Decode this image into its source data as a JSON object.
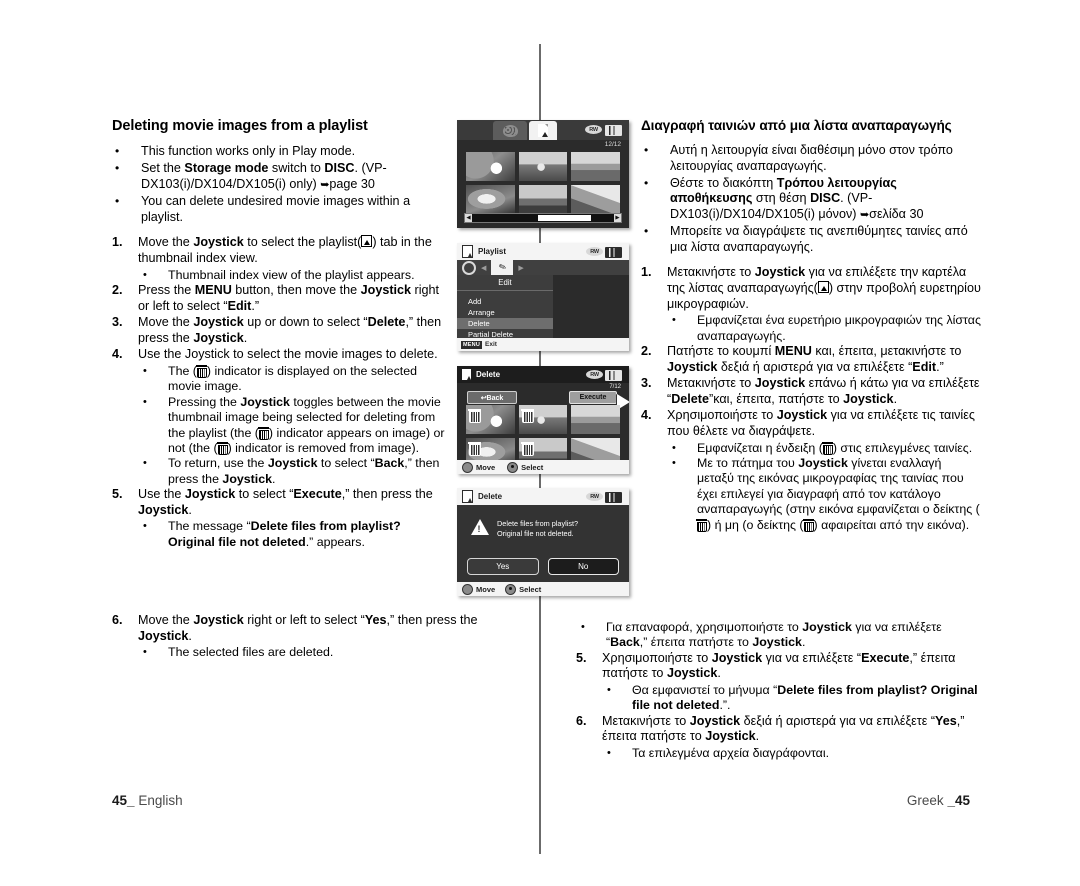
{
  "footer": {
    "left_page": "45",
    "left_sep": "_",
    "left_lang": "English",
    "right_lang": "Greek",
    "right_sep": "_",
    "right_page": "45"
  },
  "english": {
    "heading": "Deleting movie images from a playlist",
    "intro": [
      "This function works only in Play mode.",
      "Set the Storage mode switch to DISC. (VP-DX103(i)/DX104/DX105(i) only) ➜page 30",
      "You can delete undesired movie images within a playlist."
    ],
    "steps": [
      {
        "num": "1.",
        "text": "Move the Joystick to select the playlist(▣) tab in the thumbnail index view.",
        "subs": [
          "Thumbnail index view of the playlist appears."
        ]
      },
      {
        "num": "2.",
        "text": "Press the MENU button, then move the Joystick right or left to select “Edit.”",
        "subs": []
      },
      {
        "num": "3.",
        "text": "Move the Joystick up or down to select “Delete,” then press the Joystick.",
        "subs": []
      },
      {
        "num": "4.",
        "text": "Use the Joystick to select the movie images to delete.",
        "subs": [
          "The (☒) indicator is displayed on the selected movie image.",
          "Pressing the Joystick toggles between the movie thumbnail image being selected for deleting from the playlist (the (☒) indicator appears on image) or not (the (☒) indicator is removed from image).",
          "To return, use the Joystick to select “Back,” then press the Joystick."
        ]
      },
      {
        "num": "5.",
        "text": "Use the Joystick to select “Execute,” then press the Joystick.",
        "subs": [
          "The message “Delete files from playlist? Original file not deleted.” appears."
        ]
      },
      {
        "num": "6.",
        "text": "Move the Joystick right or left to select “Yes,” then press the Joystick.",
        "subs": [
          "The selected files are deleted."
        ]
      }
    ]
  },
  "greek": {
    "heading": "Διαγραφή ταινιών από μια λίστα αναπαραγωγής",
    "intro": [
      "Αυτή η λειτουργία είναι διαθέσιμη μόνο στον τρόπο λειτουργίας αναπαραγωγής.",
      "Θέστε το διακόπτη Τρόπου λειτουργίας αποθήκευσης στη θέση DISC. (VP-DX103(i)/DX104/DX105(i) μόνον) ➜σελίδα 30",
      "Μπορείτε να διαγράψετε τις ανεπιθύμητες ταινίες από μια λίστα αναπαραγωγής."
    ],
    "steps": [
      {
        "num": "1.",
        "text": "Μετακινήστε το Joystick για να επιλέξετε την καρτέλα της λίστας αναπαραγωγής(▣) στην προβολή ευρετηρίου μικρογραφιών.",
        "subs": [
          "Εμφανίζεται ένα ευρετήριο μικρογραφιών της λίστας αναπαραγωγής."
        ]
      },
      {
        "num": "2.",
        "text": "Πατήστε το κουμπί MENU και, έπειτα, μετακινήστε το Joystick δεξιά ή αριστερά για να επιλέξετε “Edit.”",
        "subs": []
      },
      {
        "num": "3.",
        "text": "Μετακινήστε το Joystick επάνω ή κάτω για να επιλέξετε “Delete”και, έπειτα, πατήστε το Joystick.",
        "subs": []
      },
      {
        "num": "4.",
        "text": "Χρησιμοποιήστε το Joystick για να επιλέξετε τις ταινίες που θέλετε να διαγράψετε.",
        "subs": [
          "Εμφανίζεται η ένδειξη (☒) στις επιλεγμένες ταινίες.",
          "Με το πάτημα του Joystick γίνεται εναλλαγή μεταξύ της εικόνας μικρογραφίας της ταινίας που έχει επιλεγεί για διαγραφή από τον κατάλογο αναπαραγωγής (στην εικόνα εμφανίζεται ο δείκτης (☒) ή μη (ο δείκτης (☒) αφαιρείται από την εικόνα)."
        ]
      }
    ],
    "wide": {
      "back_bullet": "Για επαναφορά, χρησιμοποιήστε το Joystick για να επιλέξετε “Back,” έπειτα πατήστε το Joystick.",
      "step5_num": "5.",
      "step5": "Χρησιμοποιήστε το Joystick για να επιλέξετε “Execute,” έπειτα πατήστε το Joystick.",
      "step5_sub": "Θα εμφανιστεί το μήνυμα “Delete files from playlist? Original file not deleted.”.",
      "step6_num": "6.",
      "step6": "Μετακινήστε το Joystick δεξιά ή αριστερά για να επιλέξετε “Yes,” έπειτα πατήστε το Joystick.",
      "step6_sub": "Τα επιλεγμένα αρχεία διαγράφονται."
    }
  },
  "screens": {
    "thumbnail_index": {
      "counter": "12/12",
      "tab_movie_icon": "film-icon",
      "tab_playlist_icon": "playlist-icon",
      "disc_icon": "RW",
      "battery_icon": "battery-icon",
      "scroll_left": "◀",
      "scroll_right": "▶"
    },
    "playlist_menu": {
      "title": "Playlist",
      "disc_icon": "RW",
      "tab_edit_label": "Edit",
      "items": [
        "Add",
        "Arrange",
        "Delete",
        "Partial Delete"
      ],
      "selected_item": "Delete",
      "menu_button": "MENU",
      "exit_label": "Exit"
    },
    "delete_select": {
      "title": "Delete",
      "counter": "7/12",
      "back_label": "↩Back",
      "execute_label": "Execute",
      "disc_icon": "RW",
      "move_label": "Move",
      "select_label": "Select"
    },
    "confirm_dialog": {
      "title": "Delete",
      "message_line1": "Delete files from playlist?",
      "message_line2": "Original file not deleted.",
      "yes_label": "Yes",
      "no_label": "No",
      "move_label": "Move",
      "select_label": "Select",
      "disc_icon": "RW"
    }
  }
}
